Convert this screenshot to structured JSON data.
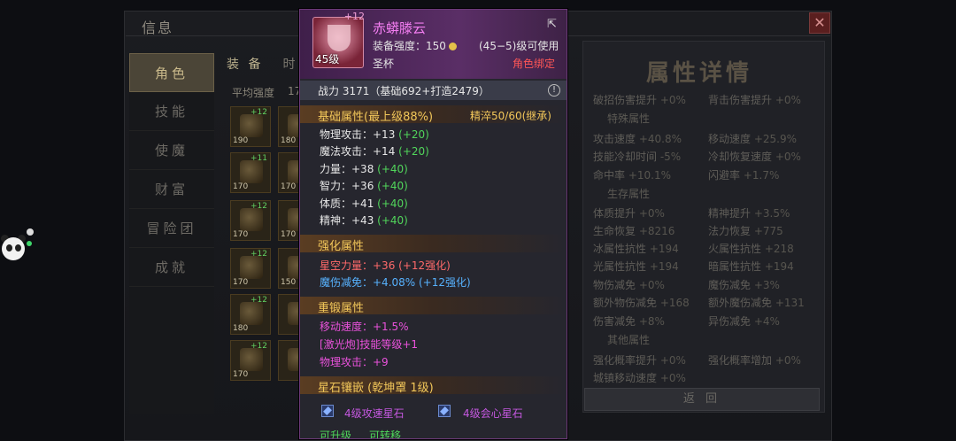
{
  "background": {
    "window_title": "信息",
    "close_glyph": "✕",
    "side_tabs": [
      "角色",
      "技能",
      "使魔",
      "财富",
      "冒险团",
      "成就"
    ],
    "equip_tabs": [
      "装 备",
      "时"
    ],
    "avg_strength_label": "平均强度",
    "avg_strength_value": "17",
    "slots": [
      {
        "level": "190",
        "plus": "+12"
      },
      {
        "level": "180",
        "plus": ""
      },
      {
        "level": "170",
        "plus": "+11"
      },
      {
        "level": "170",
        "plus": ""
      },
      {
        "level": "170",
        "plus": "+12"
      },
      {
        "level": "170",
        "plus": ""
      },
      {
        "level": "170",
        "plus": "+12"
      },
      {
        "level": "150",
        "plus": ""
      },
      {
        "level": "180",
        "plus": "+12"
      },
      {
        "level": "",
        "plus": ""
      },
      {
        "level": "170",
        "plus": "+12"
      },
      {
        "level": "",
        "plus": ""
      }
    ],
    "attr_title": "属性详情",
    "attr_rows": [
      {
        "a": "破招伤害提升",
        "av": "+0%",
        "b": "背击伤害提升",
        "bv": "+0%"
      },
      {
        "a": "攻击速度",
        "av": "+40.8%",
        "b": "移动速度",
        "bv": "+25.9%"
      },
      {
        "a": "技能冷却时间",
        "av": "-5%",
        "b": "冷却恢复速度",
        "bv": "+0%"
      },
      {
        "a": "命中率",
        "av": "+10.1%",
        "b": "闪避率",
        "bv": "+1.7%"
      },
      {
        "a": "体质提升",
        "av": "+0%",
        "b": "精神提升",
        "bv": "+3.5%"
      },
      {
        "a": "生命恢复",
        "av": "+8216",
        "b": "法力恢复",
        "bv": "+775"
      },
      {
        "a": "冰属性抗性",
        "av": "+194",
        "b": "火属性抗性",
        "bv": "+218"
      },
      {
        "a": "光属性抗性",
        "av": "+194",
        "b": "暗属性抗性",
        "bv": "+194"
      },
      {
        "a": "物伤减免",
        "av": "+0%",
        "b": "魔伤减免",
        "bv": "+3%"
      },
      {
        "a": "额外物伤减免",
        "av": "+168",
        "b": "额外魔伤减免",
        "bv": "+131"
      },
      {
        "a": "伤害减免",
        "av": "+8%",
        "b": "异伤减免",
        "bv": "+4%"
      },
      {
        "a": "强化概率提升",
        "av": "+0%",
        "b": "强化概率增加",
        "bv": "+0%"
      },
      {
        "a": "城镇移动速度",
        "av": "+0%",
        "b": "",
        "bv": ""
      }
    ],
    "attr_sections": [
      "特殊属性",
      "生存属性",
      "其他属性"
    ],
    "return_label": "返 回"
  },
  "tooltip": {
    "item_plus": "+12",
    "item_level": "45级",
    "item_name": "赤蟒滕云",
    "share_icon": "share-icon",
    "equip_strength": "装备强度：150",
    "level_req": "(45−5)级可使用",
    "item_type": "圣杯",
    "bind_status": "角色绑定",
    "power_text": "战力 3171（基础692+打造2479）",
    "info_glyph": "!",
    "base_section": "基础属性(最上级88%)",
    "refine": "精淬50/60(继承)",
    "base_stats": [
      {
        "label": "物理攻击：+13",
        "bonus": "(+20)"
      },
      {
        "label": "魔法攻击：+14",
        "bonus": "(+20)"
      },
      {
        "label": "力量：+38",
        "bonus": "(+40)"
      },
      {
        "label": "智力：+36",
        "bonus": "(+40)"
      },
      {
        "label": "体质：+41",
        "bonus": "(+40)"
      },
      {
        "label": "精神：+43",
        "bonus": "(+40)"
      }
    ],
    "enhance_section": "强化属性",
    "enhance_lines": [
      "星空力量：+36 (+12强化)",
      "魔伤减免：+4.08% (+12强化)"
    ],
    "forge_section": "重锻属性",
    "forge_lines": [
      "移动速度：+1.5%",
      "[激光炮]技能等级+1",
      "物理攻击：+9"
    ],
    "gem_section": "星石镶嵌 (乾坤罩 1级)",
    "gems": [
      "4级攻速星石",
      "4级会心星石"
    ],
    "actions": [
      "可升级",
      "可转移"
    ]
  }
}
